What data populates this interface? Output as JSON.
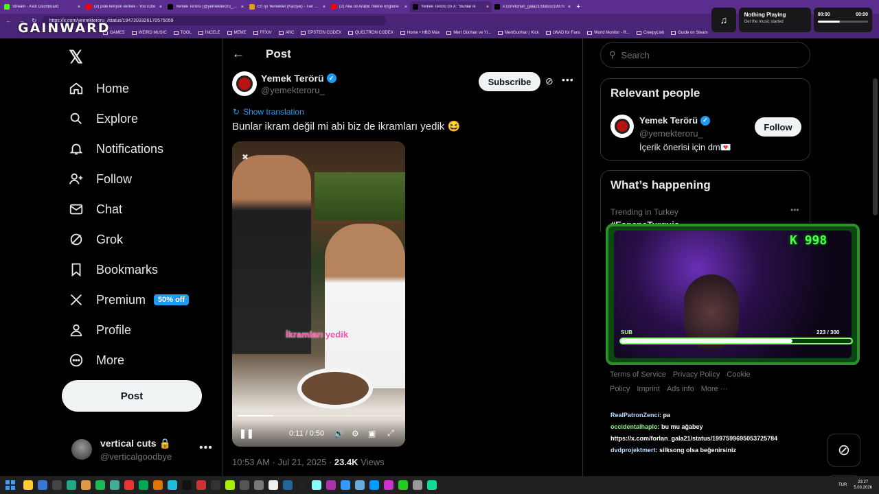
{
  "browser": {
    "tabs": [
      {
        "title": "Stream - Kick Dashboard",
        "icon": "kick-icon",
        "color": "#53fc18"
      },
      {
        "title": "(2) pide kimyon ekmek - YouTube",
        "icon": "youtube-icon",
        "color": "#ff0000"
      },
      {
        "title": "Yemek Terörü (@yemekteroru_) / X",
        "icon": "x-icon",
        "color": "#000000"
      },
      {
        "title": "En İyi Yemekler (Karışık) - Tier List",
        "icon": "tierlist-icon",
        "color": "#e2a400"
      },
      {
        "title": "(2) Afia oil Arabic meme ringtone",
        "icon": "youtube-icon",
        "color": "#ff0000"
      },
      {
        "title": "Yemek Terörü on X: \"Bunlar ik",
        "icon": "x-icon",
        "color": "#000000"
      },
      {
        "title": "x.com/forlan_gala21/status/19975",
        "icon": "x-icon",
        "color": "#000000"
      }
    ],
    "active_tab": 5,
    "url": "https://x.com/yemekteroru_/status/1947203326170575059",
    "bookmarks": [
      "GAMES",
      "WEIRD MUSIC",
      "TOOL",
      "İNCELE",
      "MEME",
      "FFXIV",
      "ARC",
      "EPSTEIN CODEX",
      "QUELTRON CODEX",
      "Home • HBO Max",
      "Mert Günhan ve Yi...",
      "MertGunhan | Kick",
      "LWAD for Fans",
      "World Monitor - R...",
      "CreepyLink",
      "Guide on Steam"
    ]
  },
  "overlay_logo": "GAINWARD",
  "media_widget": {
    "title": "Nothing Playing",
    "subtitle": "Get the music started",
    "elapsed": "00:00",
    "duration": "00:00"
  },
  "sidebar": {
    "items": [
      {
        "label": "Home",
        "icon": "home-icon"
      },
      {
        "label": "Explore",
        "icon": "search-icon"
      },
      {
        "label": "Notifications",
        "icon": "bell-icon"
      },
      {
        "label": "Follow",
        "icon": "person-add-icon"
      },
      {
        "label": "Chat",
        "icon": "mail-icon"
      },
      {
        "label": "Grok",
        "icon": "grok-icon"
      },
      {
        "label": "Bookmarks",
        "icon": "bookmark-icon"
      },
      {
        "label": "Premium",
        "icon": "x-icon",
        "badge": "50% off"
      },
      {
        "label": "Profile",
        "icon": "person-icon"
      },
      {
        "label": "More",
        "icon": "more-circle-icon"
      }
    ],
    "post_button": "Post",
    "account": {
      "name": "vertical cuts 🔒",
      "handle": "@verticalgoodbye"
    }
  },
  "post": {
    "header": "Post",
    "author_name": "Yemek Terörü",
    "author_handle": "@yemekteroru_",
    "subscribe_label": "Subscribe",
    "show_translation": "Show translation",
    "text": "Bunlar ikram değil mi abi biz de ikramları yedik 😆",
    "video": {
      "caption": "İkramları yedik",
      "time": "0:11 / 0:50",
      "progress": 0.22
    },
    "timestamp": "10:53 AM · Jul 21, 2025 · ",
    "views_count": "23.4K",
    "views_label": "Views"
  },
  "right": {
    "search_placeholder": "Search",
    "relevant_title": "Relevant people",
    "person": {
      "name": "Yemek Terörü",
      "handle": "@yemekteroru_",
      "bio": "İçerik önerisi için dm💌",
      "follow_label": "Follow"
    },
    "whats_happening_title": "What’s happening",
    "trend_context": "Trending in Turkey",
    "trend_tag": "#EspanaTurquia",
    "footer_links": [
      "Terms of Service",
      "Privacy Policy",
      "Cookie Policy",
      "Imprint",
      "Ads info",
      "More ···"
    ]
  },
  "stream_overlay": {
    "follower_count": "998",
    "sub_label": "SUB",
    "sub_current": 223,
    "sub_goal": 300,
    "sub_text": "223  / 300"
  },
  "chat": [
    {
      "user": "RealPatronZenci",
      "message": ": pa"
    },
    {
      "user": "occidentalhaplo",
      "message": ": bu mu ağabey"
    },
    {
      "user": "",
      "message": "https://x.com/forlan_gala21/status/1997599695053725784"
    },
    {
      "user": "dvdprojektmert",
      "message": ": silksong olsa beğenirsiniz"
    }
  ],
  "taskbar": {
    "language": "TUR",
    "time": "23:27",
    "date": "5.03.2026"
  }
}
